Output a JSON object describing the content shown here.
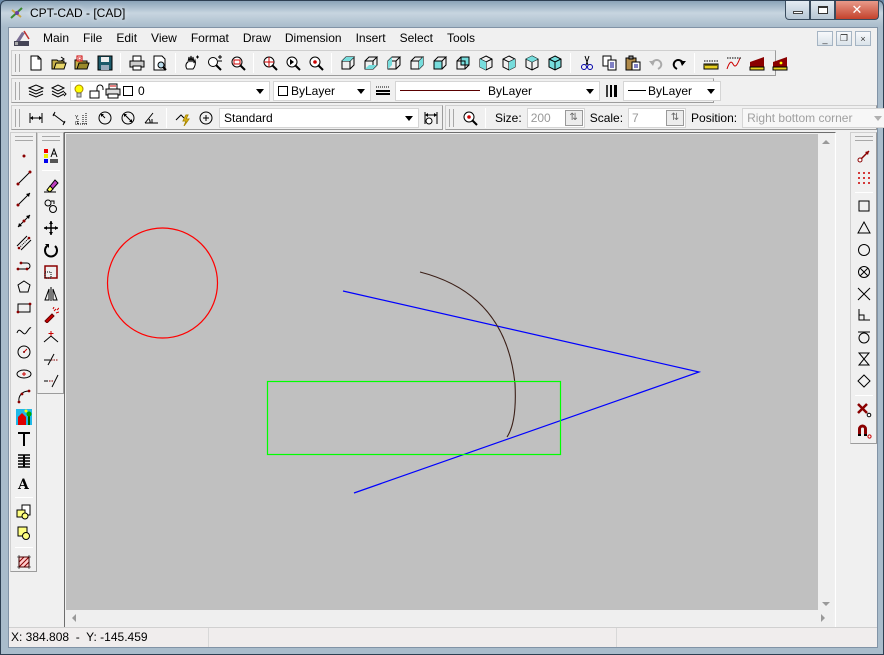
{
  "window": {
    "title": "CPT-CAD - [CAD]",
    "caption_buttons": {
      "minimize": "minimize",
      "maximize": "maximize",
      "close": "close"
    }
  },
  "menubar": {
    "items": [
      {
        "label": "Main"
      },
      {
        "label": "File"
      },
      {
        "label": "Edit"
      },
      {
        "label": "View"
      },
      {
        "label": "Format"
      },
      {
        "label": "Draw"
      },
      {
        "label": "Dimension"
      },
      {
        "label": "Insert"
      },
      {
        "label": "Select"
      },
      {
        "label": "Tools"
      }
    ],
    "mdi_buttons": {
      "minimize": "_",
      "restore": "❐",
      "close": "×"
    }
  },
  "toolbar_standard": {
    "icons": [
      "new-file-icon",
      "open-folder-icon",
      "open-recent-icon",
      "save-icon",
      "print-icon",
      "print-preview-icon",
      "pan-icon",
      "zoom-in-out-icon",
      "zoom-window-icon",
      "zoom-extents-icon",
      "zoom-previous-icon",
      "zoom-center-icon",
      "view-top-icon",
      "view-bottom-icon",
      "view-left-icon",
      "view-right-icon",
      "view-front-icon",
      "view-back-icon",
      "view-sw-iso-icon",
      "view-se-iso-icon",
      "view-ne-iso-icon",
      "view-nw-iso-icon",
      "cut-icon",
      "copy-icon",
      "paste-icon",
      "undo-icon",
      "redo-icon",
      "measure-distance-icon",
      "measure-curve-icon",
      "measure-area-icon",
      "measure-area-point-icon"
    ]
  },
  "toolbar_layers": {
    "layer_value": "0",
    "color_value": "ByLayer",
    "linetype_value": "ByLayer",
    "lineweight_value": "ByLayer"
  },
  "toolbar_dimension": {
    "style_value": "Standard",
    "size_label": "Size:",
    "size_value": "200",
    "scale_label": "Scale:",
    "scale_value": "7",
    "position_label": "Position:",
    "position_value": "Right bottom corner"
  },
  "left_toolbar_draw": {
    "icons": [
      "point-icon",
      "line-icon",
      "ray-icon",
      "xline-icon",
      "multiline-icon",
      "polyline-icon",
      "polygon-icon",
      "rectangle-icon",
      "spline-icon",
      "circle-icon",
      "ellipse-icon",
      "arc-icon",
      "insert-image-icon",
      "text-icon",
      "multiline-text-icon",
      "text-style-icon",
      "insert-block-icon",
      "make-block-icon",
      "hatch-icon"
    ]
  },
  "left_toolbar_modify": {
    "icons": [
      "properties-icon",
      "erase-icon",
      "copy-object-icon",
      "move-icon",
      "rotate-icon",
      "scale-icon",
      "mirror-icon",
      "explode-icon",
      "offset-icon",
      "trim-icon",
      "extend-icon"
    ]
  },
  "right_toolbar_snap": {
    "icons": [
      "snap-tracking-icon",
      "grid-snap-icon",
      "snap-endpoint-icon",
      "snap-midpoint-icon",
      "snap-center-icon",
      "snap-node-icon",
      "snap-intersection-icon",
      "snap-perpendicular-icon",
      "snap-tangent-icon",
      "snap-nearest-icon",
      "snap-quadrant-icon",
      "snap-none-icon",
      "snap-magnet-icon"
    ]
  },
  "drawing": {
    "background": "#c0c0c0",
    "entities": [
      {
        "type": "circle",
        "color": "#ff0000"
      },
      {
        "type": "polyline",
        "color": "#0000ff"
      },
      {
        "type": "arc",
        "color": "#3b1f17"
      },
      {
        "type": "rectangle",
        "color": "#00ff00"
      }
    ]
  },
  "statusbar": {
    "coordinates": "X: 384.808  -  Y: -145.459",
    "pane2": "",
    "pane3": ""
  }
}
